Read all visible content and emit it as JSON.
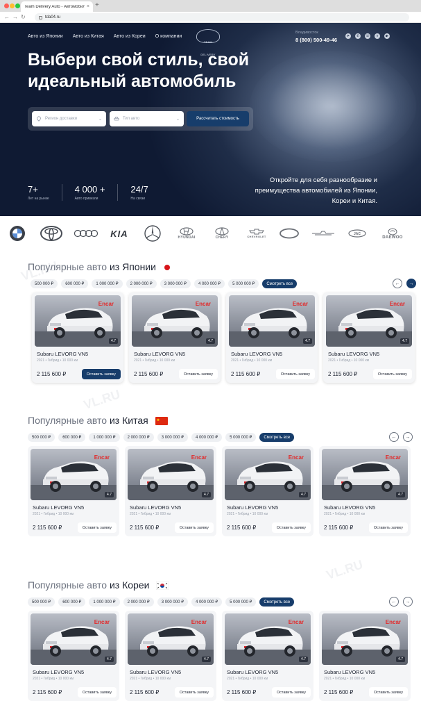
{
  "browser": {
    "tab_title": "Team Delivery Auto - Автомобили",
    "tab_close": "×",
    "new_tab": "+",
    "url": "tda04.ru"
  },
  "header": {
    "nav": [
      "Авто из Японии",
      "Авто из Китая",
      "Авто из Кореи",
      "О компании"
    ],
    "city": "Владивосток",
    "phone": "8 (800) 500-49-46"
  },
  "hero": {
    "headline": "Выбери свой стиль, свой идеальный автомобиль",
    "region_placeholder": "Регион доставки",
    "type_placeholder": "Тип авто",
    "calc_button": "Рассчитать стоимость",
    "tagline": "Откройте для себя разнообразие и преимущества автомобилей из Японии, Кореи и Китая.",
    "stats": [
      {
        "value": "7+",
        "label": "Лет на рынке"
      },
      {
        "value": "4 000 +",
        "label": "Авто привезли"
      },
      {
        "value": "24/7",
        "label": "На связи"
      }
    ]
  },
  "brands": [
    "BMW",
    "Toyota",
    "Audi",
    "KIA",
    "Mercedes-Benz",
    "HYUNDAI",
    "CHERY",
    "CHEVROLET",
    "Haval",
    "GENESIS",
    "JAC",
    "DAEWOO"
  ],
  "price_chips": [
    "500 000 ₽",
    "600 000 ₽",
    "1 000 000 ₽",
    "2 000 000 ₽",
    "3 000 000 ₽",
    "4 000 000 ₽",
    "5 000 000 ₽"
  ],
  "see_all": "Смотреть все",
  "sections": [
    {
      "prefix": "Популярные авто",
      "country": "из Японии"
    },
    {
      "prefix": "Популярные авто",
      "country": "из Китая"
    },
    {
      "prefix": "Популярные авто",
      "country": "из Кореи"
    }
  ],
  "card": {
    "source_label": "Encar",
    "rating": "4.7",
    "name": "Subaru LEVORG VN5",
    "meta": "2021 • Гибрид • 10 000 км",
    "price": "2 115 600 ₽",
    "request_button": "Оставить заявку"
  },
  "watermark": "VL.RU",
  "colors": {
    "accent": "#173d6b",
    "hero_bg": "#0f1a33",
    "brand_red": "#e22b2b"
  }
}
